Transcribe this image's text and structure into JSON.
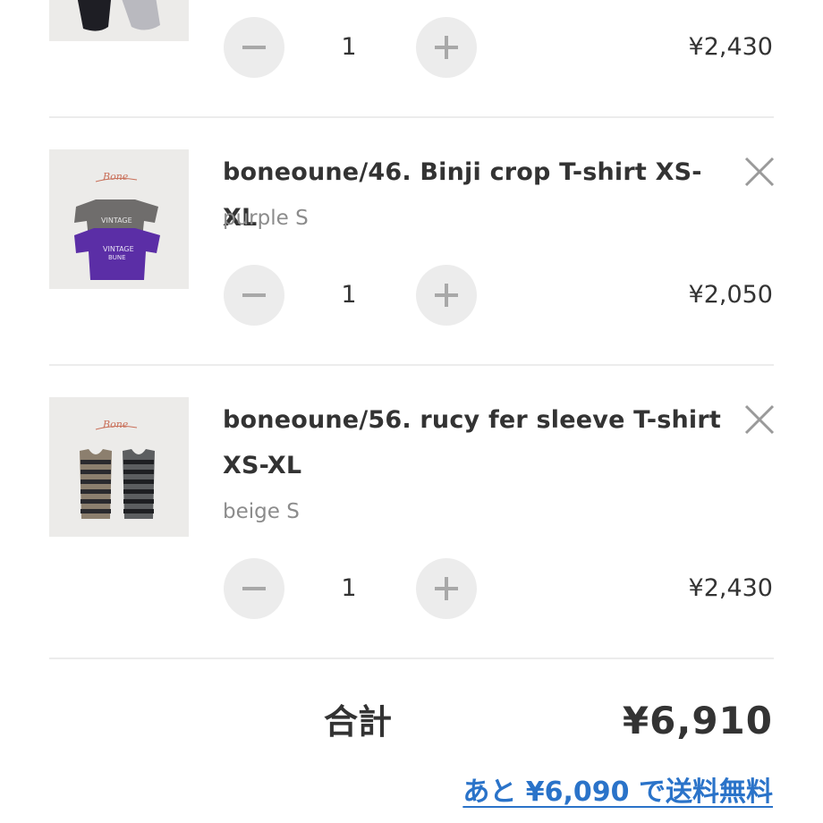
{
  "cart": {
    "items": [
      {
        "title": "",
        "variant": "",
        "quantity": "1",
        "price": "¥2,430",
        "image_icon": "shorts-product-image"
      },
      {
        "title": "boneoune/46. Binji crop T-shirt XS-XL",
        "variant": "purple S",
        "quantity": "1",
        "price": "¥2,050",
        "image_icon": "tshirt-product-image"
      },
      {
        "title": "boneoune/56. rucy fer sleeve T-shirt XS-XL",
        "variant": "beige S",
        "quantity": "1",
        "price": "¥2,430",
        "image_icon": "striped-sleeveless-product-image"
      }
    ],
    "controls": {
      "minus_icon": "minus-icon",
      "plus_icon": "plus-icon",
      "remove_icon": "close-icon"
    }
  },
  "summary": {
    "total_label": "合計",
    "total_value": "¥6,910",
    "free_shipping_note": "あと ¥6,090 で送料無料"
  },
  "colors": {
    "link": "#2a73c9",
    "text": "#333333",
    "muted": "#8c8c8c",
    "stepper_bg": "#ececec",
    "purple_shirt": "#5b2ea6"
  }
}
